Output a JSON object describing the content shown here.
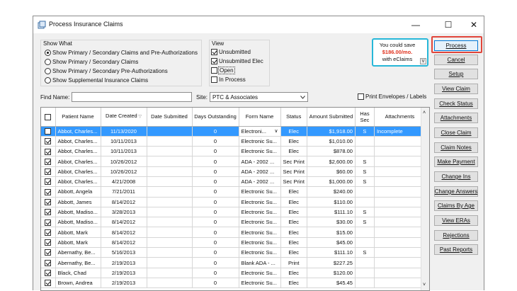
{
  "window": {
    "title": "Process Insurance Claims",
    "minimize": "—",
    "maximize": "☐",
    "close": "✕"
  },
  "show_what": {
    "label": "Show What",
    "options": [
      {
        "label": "Show Primary / Secondary Claims and Pre-Authorizations",
        "selected": true
      },
      {
        "label": "Show Primary / Secondary Claims",
        "selected": false
      },
      {
        "label": "Show Primary / Secondary Pre-Authorizations",
        "selected": false
      },
      {
        "label": "Show Supplemental Insurance Claims",
        "selected": false
      }
    ]
  },
  "view": {
    "label": "View",
    "options": [
      {
        "label": "Unsubmitted",
        "checked": true
      },
      {
        "label": "Unsubmitted Elec",
        "checked": true
      },
      {
        "label": "Open",
        "checked": false
      },
      {
        "label": "In Process",
        "checked": false
      }
    ]
  },
  "ad": {
    "line1": "You could save",
    "line2": "$186.00/mo.",
    "line3": "with eClaims",
    "toggle": "V"
  },
  "find": {
    "label": "Find Name:",
    "value": ""
  },
  "site": {
    "label": "Site:",
    "value": "PTC & Associates"
  },
  "print_env": {
    "label": "Print Envelopes / Labels",
    "checked": false
  },
  "columns": [
    "Patient Name",
    "Date Created",
    "Date Submitted",
    "Days Outstanding",
    "Form Name",
    "Status",
    "Amount Submitted",
    "Has Sec",
    "Attachments"
  ],
  "rows": [
    {
      "checked": false,
      "name": "Abbot, Charles...",
      "created": "11/13/2020",
      "submitted": "",
      "days": "0",
      "form": "Electroni...",
      "status": "Elec",
      "amount": "$1,918.00",
      "sec": "S",
      "attach": "Incomplete"
    },
    {
      "checked": true,
      "name": "Abbot, Charles...",
      "created": "10/11/2013",
      "submitted": "",
      "days": "0",
      "form": "Electronic Su...",
      "status": "Elec",
      "amount": "$1,010.00",
      "sec": "",
      "attach": ""
    },
    {
      "checked": true,
      "name": "Abbot, Charles...",
      "created": "10/11/2013",
      "submitted": "",
      "days": "0",
      "form": "Electronic Su...",
      "status": "Elec",
      "amount": "$878.00",
      "sec": "",
      "attach": ""
    },
    {
      "checked": true,
      "name": "Abbot, Charles...",
      "created": "10/26/2012",
      "submitted": "",
      "days": "0",
      "form": "ADA - 2002 ...",
      "status": "Sec Print",
      "amount": "$2,600.00",
      "sec": "S",
      "attach": ""
    },
    {
      "checked": true,
      "name": "Abbot, Charles...",
      "created": "10/26/2012",
      "submitted": "",
      "days": "0",
      "form": "ADA - 2002 ...",
      "status": "Sec Print",
      "amount": "$60.00",
      "sec": "S",
      "attach": ""
    },
    {
      "checked": true,
      "name": "Abbot, Charles...",
      "created": "4/21/2008",
      "submitted": "",
      "days": "0",
      "form": "ADA - 2002 ...",
      "status": "Sec Print",
      "amount": "$1,000.00",
      "sec": "S",
      "attach": ""
    },
    {
      "checked": true,
      "name": "Abbott, Angela",
      "created": "7/21/2011",
      "submitted": "",
      "days": "0",
      "form": "Electronic Su...",
      "status": "Elec",
      "amount": "$240.00",
      "sec": "",
      "attach": ""
    },
    {
      "checked": true,
      "name": "Abbott, James",
      "created": "8/14/2012",
      "submitted": "",
      "days": "0",
      "form": "Electronic Su...",
      "status": "Elec",
      "amount": "$110.00",
      "sec": "",
      "attach": ""
    },
    {
      "checked": true,
      "name": "Abbott, Madiso...",
      "created": "3/28/2013",
      "submitted": "",
      "days": "0",
      "form": "Electronic Su...",
      "status": "Elec",
      "amount": "$111.10",
      "sec": "S",
      "attach": ""
    },
    {
      "checked": true,
      "name": "Abbott, Madiso...",
      "created": "8/14/2012",
      "submitted": "",
      "days": "0",
      "form": "Electronic Su...",
      "status": "Elec",
      "amount": "$30.00",
      "sec": "S",
      "attach": ""
    },
    {
      "checked": true,
      "name": "Abbott, Mark",
      "created": "8/14/2012",
      "submitted": "",
      "days": "0",
      "form": "Electronic Su...",
      "status": "Elec",
      "amount": "$15.00",
      "sec": "",
      "attach": ""
    },
    {
      "checked": true,
      "name": "Abbott, Mark",
      "created": "8/14/2012",
      "submitted": "",
      "days": "0",
      "form": "Electronic Su...",
      "status": "Elec",
      "amount": "$45.00",
      "sec": "",
      "attach": ""
    },
    {
      "checked": true,
      "name": "Abernathy, Be...",
      "created": "5/16/2013",
      "submitted": "",
      "days": "0",
      "form": "Electronic Su...",
      "status": "Elec",
      "amount": "$111.10",
      "sec": "S",
      "attach": ""
    },
    {
      "checked": true,
      "name": "Abernathy, Be...",
      "created": "2/19/2013",
      "submitted": "",
      "days": "0",
      "form": "Blank ADA - ...",
      "status": "Print",
      "amount": "$227.25",
      "sec": "",
      "attach": ""
    },
    {
      "checked": true,
      "name": "Black, Chad",
      "created": "2/19/2013",
      "submitted": "",
      "days": "0",
      "form": "Electronic Su...",
      "status": "Elec",
      "amount": "$120.00",
      "sec": "",
      "attach": ""
    },
    {
      "checked": true,
      "name": "Brown, Andrea",
      "created": "2/19/2013",
      "submitted": "",
      "days": "0",
      "form": "Electronic Su...",
      "status": "Elec",
      "amount": "$45.45",
      "sec": "",
      "attach": ""
    }
  ],
  "buttons": [
    "Process",
    "Cancel",
    "Setup",
    "View Claim",
    "Check Status",
    "Attachments",
    "Close Claim",
    "Claim Notes",
    "Make Payment",
    "Change Ins",
    "Change Answers",
    "Claims By Age",
    "View ERAs",
    "Rejections",
    "Past Reports"
  ],
  "colors": {
    "selection": "#3399ff",
    "ad_border": "#27b7d8",
    "ad_price": "#e0331f",
    "process_highlight": "#e1453a"
  }
}
